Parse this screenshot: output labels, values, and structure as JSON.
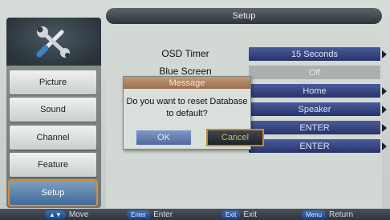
{
  "title": "Setup",
  "sidebar": {
    "items": [
      {
        "label": "Picture"
      },
      {
        "label": "Sound"
      },
      {
        "label": "Channel"
      },
      {
        "label": "Feature"
      },
      {
        "label": "Setup"
      }
    ]
  },
  "rows": [
    {
      "label": "OSD Timer",
      "value": "15 Seconds"
    },
    {
      "label": "Blue Screen",
      "value": "Off"
    },
    {
      "label": "",
      "value": "Home"
    },
    {
      "label": "",
      "value": "Speaker"
    },
    {
      "label": "",
      "value": "ENTER"
    },
    {
      "label": "",
      "value": "ENTER"
    }
  ],
  "dialog": {
    "title": "Message",
    "line1": "Do you want to reset Database",
    "line2": "to default?",
    "ok": "OK",
    "cancel": "Cancel"
  },
  "footer": {
    "move_key": "▲▼",
    "move": "Move",
    "enter_key": "Enter",
    "enter": "Enter",
    "exit_key": "Exit",
    "exit": "Exit",
    "menu_key": "Menu",
    "return": "Return"
  },
  "colors": {
    "accent_blue": "#27336b",
    "highlight_orange": "#d98b35"
  }
}
